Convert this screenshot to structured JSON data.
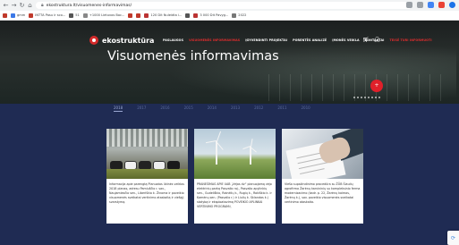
{
  "browser": {
    "url": "ekostruktura.lt/visuomenes-informavimas/",
    "nav": [
      "←",
      "→",
      "↻",
      "⌂"
    ],
    "bookmarks": [
      {
        "label": "gmm",
        "color": "#3b78e7"
      },
      {
        "label": "INTTA Pasu ir sco...",
        "color": "#c0392b"
      },
      {
        "label": "51",
        "color": "#555555"
      },
      {
        "label": "+1000 Lietuvos Boc...",
        "color": "#888888"
      },
      {
        "label": "",
        "color": "#c0392b"
      },
      {
        "label": "",
        "color": "#c0392b"
      },
      {
        "label": "120 Dit Nuleidta i...",
        "color": "#b33"
      },
      {
        "label": "",
        "color": "#555555"
      },
      {
        "label": "3 000 Dit Pavyg...",
        "color": "#b33"
      },
      {
        "label": "2022",
        "color": "#777777"
      }
    ]
  },
  "site": {
    "logo": "ekostruktūra",
    "nav": [
      {
        "label": "PASLAUGOS",
        "active": false
      },
      {
        "label": "VISUOMENĖS INFORMAVIMAS",
        "active": true
      },
      {
        "label": "ĮGYVENDINTI PROJEKTAI",
        "active": false
      },
      {
        "label": "PORENTĖS ANALIZĖ",
        "active": false
      },
      {
        "label": "ĮMONĖS VEIKLA",
        "active": false
      },
      {
        "label": "KONTAKTAI",
        "active": false
      },
      {
        "label": "TEISĖ TURI INFORMUOTI",
        "active": true
      }
    ],
    "cart_icon": "cart-icon",
    "user_icon": "user-icon",
    "title": "Visuomenės informavimas",
    "fab_label": "+"
  },
  "years": [
    {
      "label": "2018",
      "active": true
    },
    {
      "label": "2017",
      "active": false
    },
    {
      "label": "2016",
      "active": false
    },
    {
      "label": "2015",
      "active": false
    },
    {
      "label": "2014",
      "active": false
    },
    {
      "label": "2013",
      "active": false
    },
    {
      "label": "2012",
      "active": false
    },
    {
      "label": "2011",
      "active": false
    },
    {
      "label": "2010",
      "active": false
    }
  ],
  "cards": [
    {
      "image": "barn-with-cows",
      "text": "Informacija apie parengtą Planuotos ūkinės veiklos 2018 planas, adresu Pamiuščio r. sav., Naujamiesčio sen., Liberiškio k. Žinoma ir poveikio visuomenės sveikatai vertinimo ataskaitą ir viešąjį svarstymą."
    },
    {
      "image": "wind-turbines",
      "text": "PRANEŠIMAS APIE UAB „Vėjas dv“ planuojamą vėjo elektrinių parką Pasvalio raj., Pasvalio apylinkių sen., Gudeliškio, Rainėlių k., Rugių k., Rokiškio k. ir Kamėnų sen. (Pasvalio r.) ir Liulių k. Sklandas k.) statybą ir eksploatavimą POVEIKIO APLINKAI VERTINIMO PROGRAMĄ"
    },
    {
      "image": "signing-document",
      "text": "Viešo supažindinimo procedūra su ŽŪB Šiaulių agrofirma Žarėnų karvininių su kompleksinio ferma modernizacimo (kadr. p. 22, Žarėnų kaimas, Žarėnų k.), sav. poveikio visuomenės sveikatai vertinimo ataskaita."
    }
  ],
  "colors": {
    "site_bg": "#1f2b53",
    "accent_red": "#e0202a",
    "year_inactive": "#5a6a9c",
    "year_active": "#9aa7d2"
  }
}
